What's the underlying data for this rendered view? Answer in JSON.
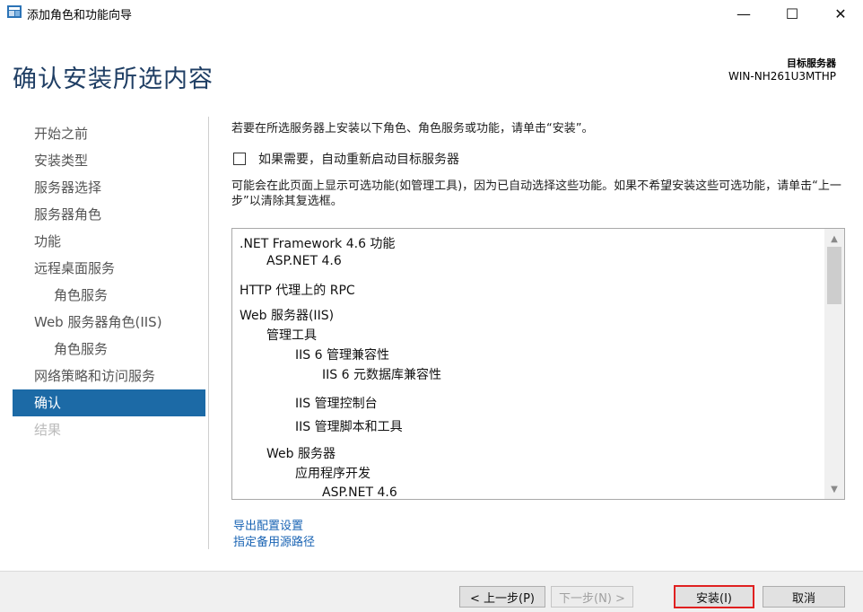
{
  "window": {
    "title": "添加角色和功能向导",
    "minimize_glyph": "—",
    "maximize_glyph": "☐",
    "close_glyph": "✕"
  },
  "header": {
    "page_title": "确认安装所选内容",
    "target_label": "目标服务器",
    "target_name": "WIN-NH261U3MTHP"
  },
  "nav": {
    "items": [
      {
        "label": "开始之前"
      },
      {
        "label": "安装类型"
      },
      {
        "label": "服务器选择"
      },
      {
        "label": "服务器角色"
      },
      {
        "label": "功能"
      },
      {
        "label": "远程桌面服务"
      },
      {
        "label": "角色服务"
      },
      {
        "label": "Web 服务器角色(IIS)"
      },
      {
        "label": "角色服务"
      },
      {
        "label": "网络策略和访问服务"
      },
      {
        "label": "确认"
      },
      {
        "label": "结果"
      }
    ]
  },
  "main": {
    "intro": "若要在所选服务器上安装以下角色、角色服务或功能，请单击“安装”。",
    "restart_checkbox_label": "如果需要，自动重新启动目标服务器",
    "restart_checked": false,
    "note": "可能会在此页面上显示可选功能(如管理工具)，因为已自动选择这些功能。如果不希望安装这些可选功能，请单击“上一步”以清除其复选框。",
    "features": [
      ".NET Framework 4.6 功能",
      "ASP.NET 4.6",
      "HTTP 代理上的 RPC",
      "Web 服务器(IIS)",
      "管理工具",
      "IIS 6 管理兼容性",
      "IIS 6 元数据库兼容性",
      "IIS 管理控制台",
      "IIS 管理脚本和工具",
      "Web 服务器",
      "应用程序开发",
      "ASP.NET 4.6"
    ],
    "scroll_up_glyph": "▲",
    "scroll_down_glyph": "▼",
    "links": {
      "export": "导出配置设置",
      "alt_source": "指定备用源路径"
    }
  },
  "footer": {
    "prev_label": "< 上一步(P)",
    "next_label": "下一步(N) >",
    "install_label": "安装(I)",
    "cancel_label": "取消"
  },
  "colors": {
    "accent": "#1c6aa6",
    "heading": "#1f3e64",
    "link": "#1a64b4",
    "highlight": "#e02020"
  }
}
